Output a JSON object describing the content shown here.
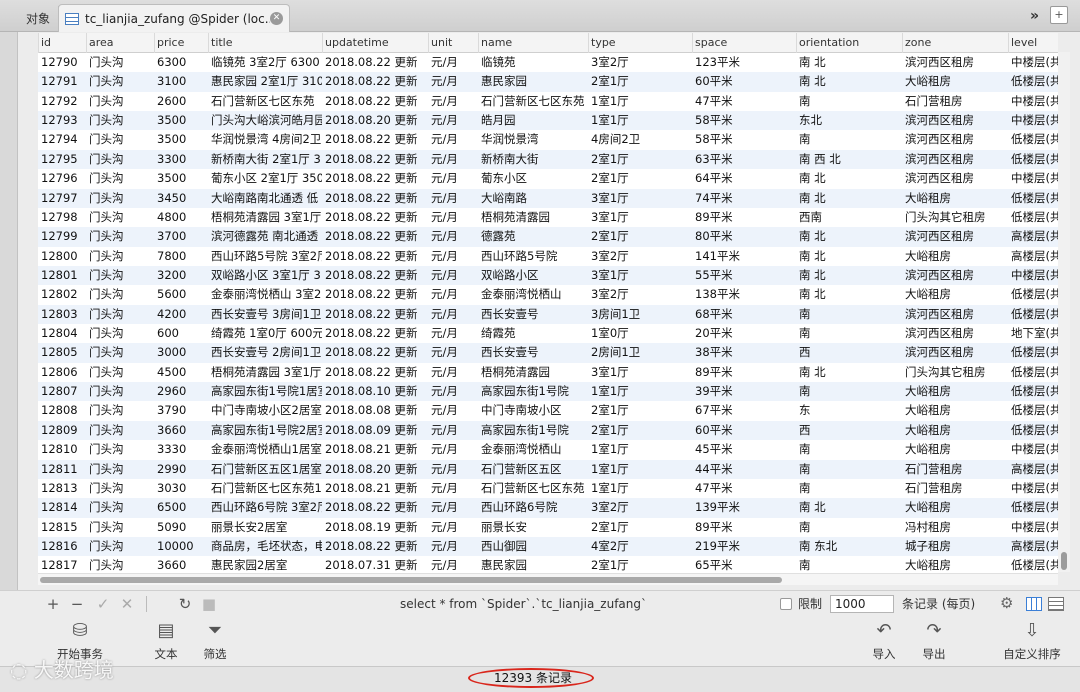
{
  "tabs": {
    "objects_label": "对象",
    "active_label": "tc_lianjia_zufang @Spider (loc...",
    "more_glyph": "»",
    "new_tab_glyph": "+"
  },
  "grid": {
    "columns": [
      "id",
      "area",
      "price",
      "title",
      "updatetime",
      "unit",
      "name",
      "type",
      "space",
      "orientation",
      "zone",
      "level"
    ],
    "rows": [
      [
        "12790",
        "门头沟",
        "6300",
        "临镜苑 3室2厅 6300",
        "2018.08.22 更新",
        "元/月",
        "临镜苑",
        "3室2厅",
        "123平米",
        "南 北",
        "滨河西区租房",
        "中楼层(共"
      ],
      [
        "12791",
        "门头沟",
        "3100",
        "惠民家园 2室1厅 310",
        "2018.08.22 更新",
        "元/月",
        "惠民家园",
        "2室1厅",
        "60平米",
        "南 北",
        "大峪租房",
        "低楼层(共"
      ],
      [
        "12792",
        "门头沟",
        "2600",
        "石门营新区七区东苑",
        "2018.08.22 更新",
        "元/月",
        "石门营新区七区东苑",
        "1室1厅",
        "47平米",
        "南",
        "石门营租房",
        "中楼层(共"
      ],
      [
        "12793",
        "门头沟",
        "3500",
        "门头沟大峪滨河皓月园",
        "2018.08.20 更新",
        "元/月",
        "皓月园",
        "1室1厅",
        "58平米",
        "东北",
        "滨河西区租房",
        "中楼层(共"
      ],
      [
        "12794",
        "门头沟",
        "3500",
        "华润悦景湾 4房间2卫",
        "2018.08.22 更新",
        "元/月",
        "华润悦景湾",
        "4房间2卫",
        "58平米",
        "南",
        "滨河西区租房",
        "低楼层(共"
      ],
      [
        "12795",
        "门头沟",
        "3300",
        "新桥南大街 2室1厅 3",
        "2018.08.22 更新",
        "元/月",
        "新桥南大街",
        "2室1厅",
        "63平米",
        "南 西 北",
        "滨河西区租房",
        "低楼层(共"
      ],
      [
        "12796",
        "门头沟",
        "3500",
        "葡东小区 2室1厅 350",
        "2018.08.22 更新",
        "元/月",
        "葡东小区",
        "2室1厅",
        "64平米",
        "南 北",
        "滨河西区租房",
        "中楼层(共"
      ],
      [
        "12797",
        "门头沟",
        "3450",
        "大峪南路南北通透 低",
        "2018.08.22 更新",
        "元/月",
        "大峪南路",
        "3室1厅",
        "74平米",
        "南 北",
        "大峪租房",
        "低楼层(共"
      ],
      [
        "12798",
        "门头沟",
        "4800",
        "梧桐苑清露园 3室1厅",
        "2018.08.22 更新",
        "元/月",
        "梧桐苑清露园",
        "3室1厅",
        "89平米",
        "西南",
        "门头沟其它租房",
        "低楼层(共"
      ],
      [
        "12799",
        "门头沟",
        "3700",
        "滨河德露苑 南北通透",
        "2018.08.22 更新",
        "元/月",
        "德露苑",
        "2室1厅",
        "80平米",
        "南 北",
        "滨河西区租房",
        "高楼层(共"
      ],
      [
        "12800",
        "门头沟",
        "7800",
        "西山环路5号院 3室2厅",
        "2018.08.22 更新",
        "元/月",
        "西山环路5号院",
        "3室2厅",
        "141平米",
        "南 北",
        "大峪租房",
        "高楼层(共"
      ],
      [
        "12801",
        "门头沟",
        "3200",
        "双峪路小区 3室1厅 3",
        "2018.08.22 更新",
        "元/月",
        "双峪路小区",
        "3室1厅",
        "55平米",
        "南 北",
        "滨河西区租房",
        "中楼层(共"
      ],
      [
        "12802",
        "门头沟",
        "5600",
        "金泰丽湾悦栖山 3室2",
        "2018.08.22 更新",
        "元/月",
        "金泰丽湾悦栖山",
        "3室2厅",
        "138平米",
        "南 北",
        "大峪租房",
        "低楼层(共"
      ],
      [
        "12803",
        "门头沟",
        "4200",
        "西长安壹号 3房间1卫",
        "2018.08.22 更新",
        "元/月",
        "西长安壹号",
        "3房间1卫",
        "68平米",
        "南",
        "滨河西区租房",
        "低楼层(共"
      ],
      [
        "12804",
        "门头沟",
        "600",
        "绮霞苑 1室0厅 600元",
        "2018.08.22 更新",
        "元/月",
        "绮霞苑",
        "1室0厅",
        "20平米",
        "南",
        "滨河西区租房",
        "地下室(共"
      ],
      [
        "12805",
        "门头沟",
        "3000",
        "西长安壹号 2房间1卫",
        "2018.08.22 更新",
        "元/月",
        "西长安壹号",
        "2房间1卫",
        "38平米",
        "西",
        "滨河西区租房",
        "低楼层(共"
      ],
      [
        "12806",
        "门头沟",
        "4500",
        "梧桐苑清露园 3室1厅",
        "2018.08.22 更新",
        "元/月",
        "梧桐苑清露园",
        "3室1厅",
        "89平米",
        "南 北",
        "门头沟其它租房",
        "低楼层(共"
      ],
      [
        "12807",
        "门头沟",
        "2960",
        "高家园东街1号院1居室",
        "2018.08.10 更新",
        "元/月",
        "高家园东街1号院",
        "1室1厅",
        "39平米",
        "南",
        "大峪租房",
        "低楼层(共"
      ],
      [
        "12808",
        "门头沟",
        "3790",
        "中门寺南坡小区2居室",
        "2018.08.08 更新",
        "元/月",
        "中门寺南坡小区",
        "2室1厅",
        "67平米",
        "东",
        "大峪租房",
        "低楼层(共"
      ],
      [
        "12809",
        "门头沟",
        "3660",
        "高家园东街1号院2居室",
        "2018.08.09 更新",
        "元/月",
        "高家园东街1号院",
        "2室1厅",
        "60平米",
        "西",
        "大峪租房",
        "低楼层(共"
      ],
      [
        "12810",
        "门头沟",
        "3330",
        "金泰丽湾悦栖山1居室",
        "2018.08.21 更新",
        "元/月",
        "金泰丽湾悦栖山",
        "1室1厅",
        "45平米",
        "南",
        "大峪租房",
        "中楼层(共"
      ],
      [
        "12811",
        "门头沟",
        "2990",
        "石门营新区五区1居室",
        "2018.08.20 更新",
        "元/月",
        "石门营新区五区",
        "1室1厅",
        "44平米",
        "南",
        "石门营租房",
        "高楼层(共"
      ],
      [
        "12813",
        "门头沟",
        "3030",
        "石门营新区七区东苑1",
        "2018.08.21 更新",
        "元/月",
        "石门营新区七区东苑",
        "1室1厅",
        "47平米",
        "南",
        "石门营租房",
        "中楼层(共"
      ],
      [
        "12814",
        "门头沟",
        "6500",
        "西山环路6号院 3室2厅",
        "2018.08.22 更新",
        "元/月",
        "西山环路6号院",
        "3室2厅",
        "139平米",
        "南 北",
        "大峪租房",
        "低楼层(共"
      ],
      [
        "12815",
        "门头沟",
        "5090",
        "丽景长安2居室",
        "2018.08.19 更新",
        "元/月",
        "丽景长安",
        "2室1厅",
        "89平米",
        "南",
        "冯村租房",
        "中楼层(共"
      ],
      [
        "12816",
        "门头沟",
        "10000",
        "商品房，毛坯状态，电",
        "2018.08.22 更新",
        "元/月",
        "西山御园",
        "4室2厅",
        "219平米",
        "南 东北",
        "城子租房",
        "高楼层(共"
      ],
      [
        "12817",
        "门头沟",
        "3660",
        "惠民家园2居室",
        "2018.07.31 更新",
        "元/月",
        "惠民家园",
        "2室1厅",
        "65平米",
        "南",
        "大峪租房",
        "低楼层(共"
      ]
    ]
  },
  "toolbar": {
    "add_glyph": "+",
    "remove_glyph": "−",
    "apply_glyph": "✓",
    "discard_glyph": "✕",
    "refresh_glyph": "↻",
    "stop_glyph": "■",
    "sql_text": "select * from `Spider`.`tc_lianjia_zufang`",
    "limit_label": "限制",
    "limit_value": "1000",
    "per_page_label": "条记录 (每页)"
  },
  "actions": {
    "begin_transaction": "开始事务",
    "text": "文本",
    "filter": "筛选",
    "import": "导入",
    "export": "导出",
    "custom_sort": "自定义排序"
  },
  "status": {
    "record_count": "12393 条记录"
  },
  "watermark": {
    "text": "大数跨境"
  },
  "colors": {
    "row_alt": "#edf3fb",
    "highlight_oval": "#d9261c",
    "accent": "#3b7fd6"
  }
}
